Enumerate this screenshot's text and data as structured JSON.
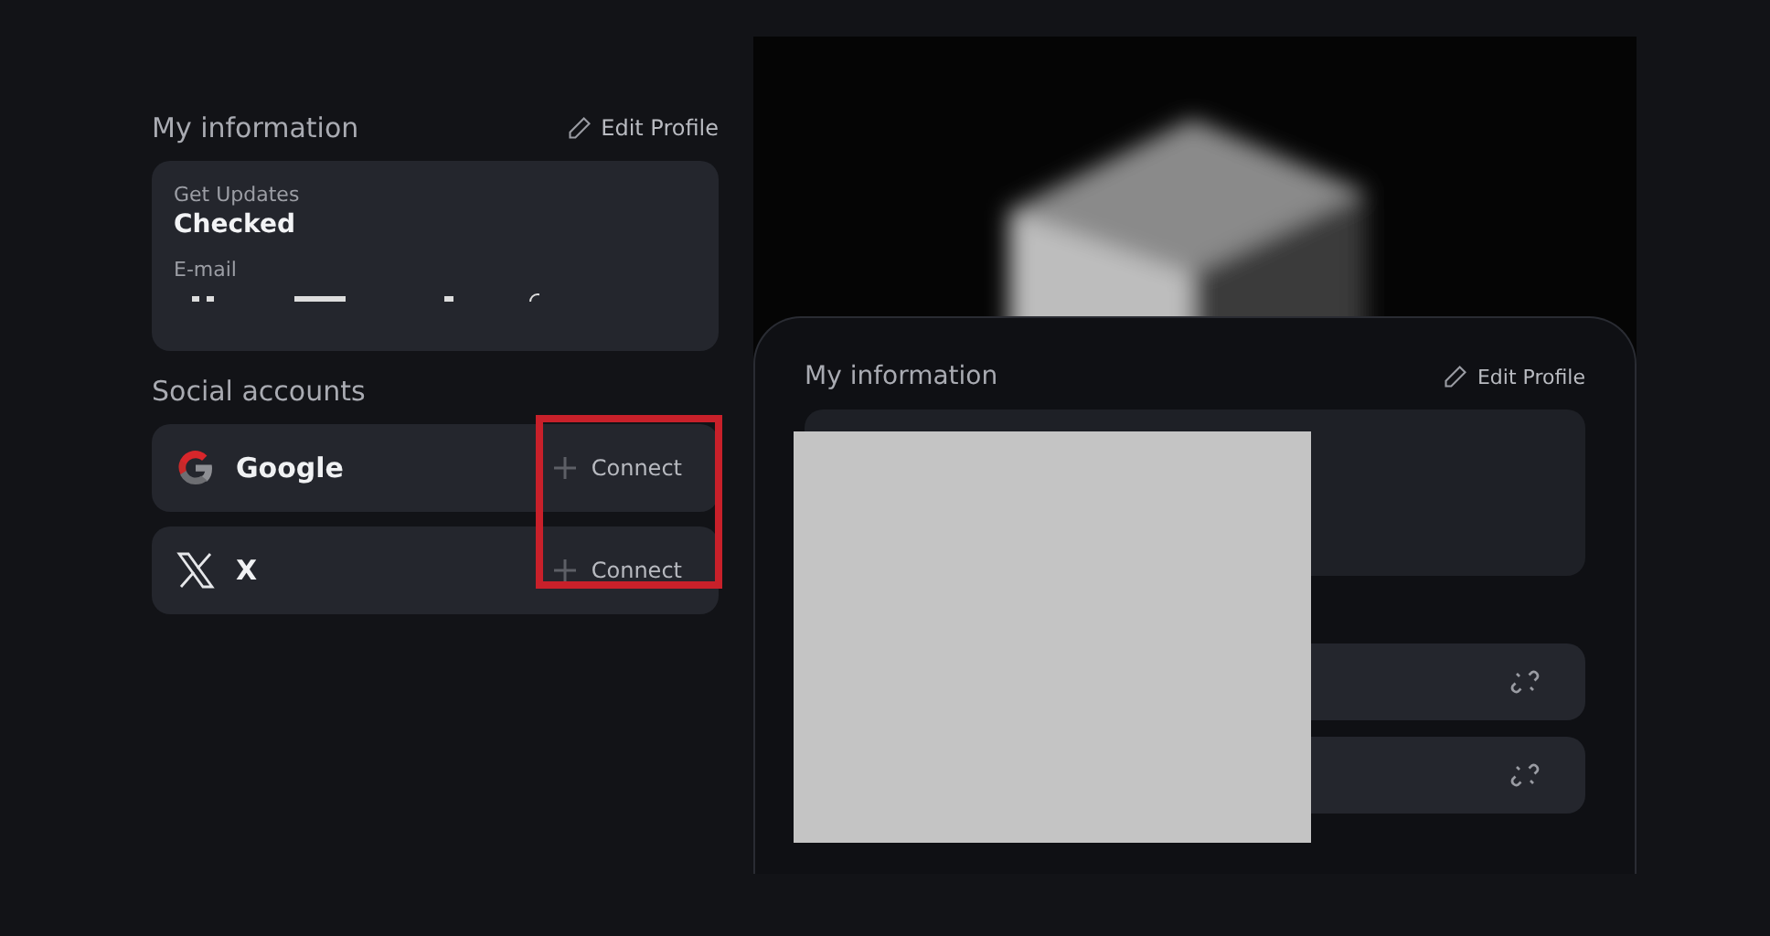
{
  "my_information": {
    "title": "My information",
    "edit_action": "Edit Profile",
    "fields": [
      {
        "label": "Get Updates",
        "value": "Checked"
      },
      {
        "label": "E-mail",
        "value_redacted": true
      }
    ]
  },
  "social_accounts": {
    "title": "Social accounts",
    "accounts": [
      {
        "name": "Google",
        "kind": "google",
        "action": "Connect"
      },
      {
        "name": "X",
        "kind": "x",
        "action": "Connect"
      }
    ]
  },
  "preview": {
    "title": "My information",
    "edit_action": "Edit Profile",
    "rows": [
      {
        "kind": "link"
      },
      {
        "kind": "link"
      }
    ]
  }
}
